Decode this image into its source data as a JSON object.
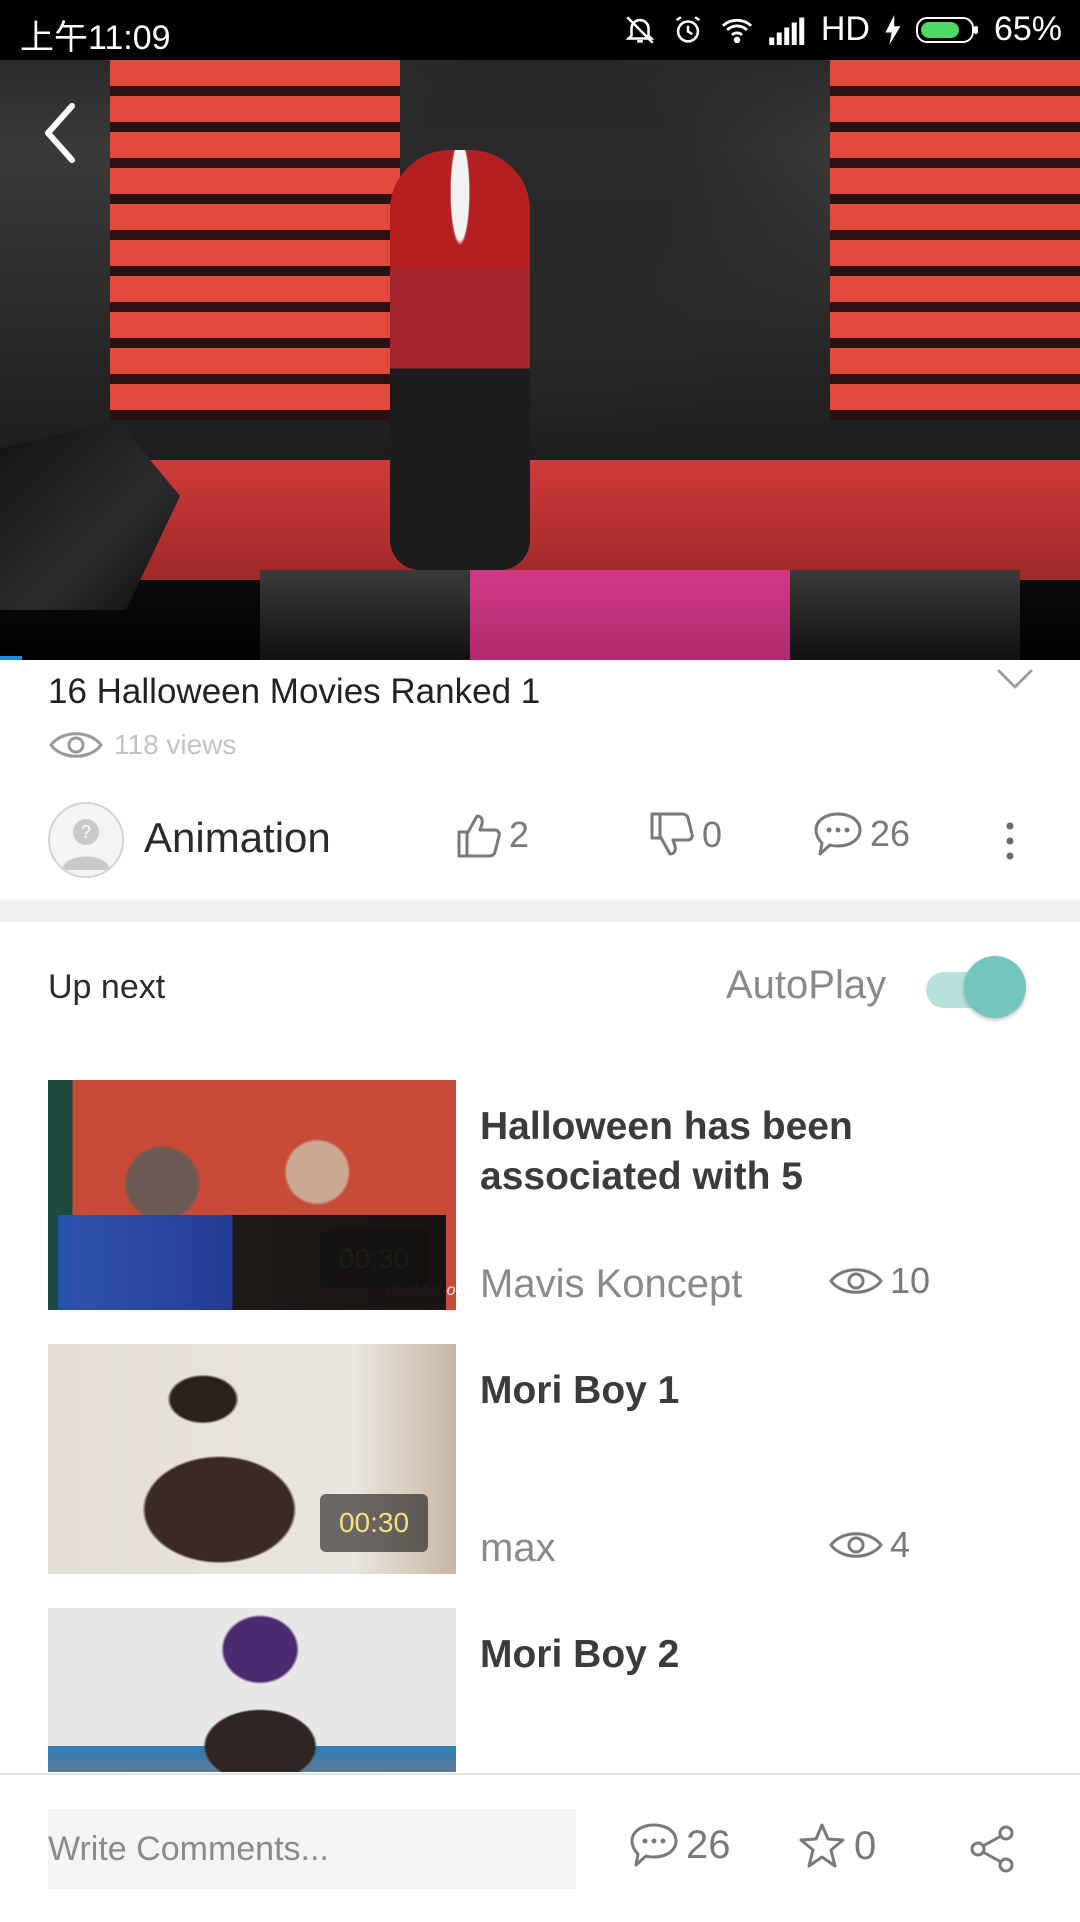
{
  "status_bar": {
    "time": "上午11:09",
    "network": "HD",
    "battery": "65%",
    "icons": [
      "mute-vibrate-icon",
      "alarm-icon",
      "wifi-icon",
      "signal-icon",
      "charging-icon",
      "battery-icon"
    ]
  },
  "video": {
    "title": "16 Halloween Movies Ranked 1",
    "views": "118 views",
    "channel": "Animation",
    "likes": "2",
    "dislikes": "0",
    "comments": "26"
  },
  "up_next": {
    "label": "Up next",
    "autoplay_label": "AutoPlay",
    "autoplay_on": true,
    "items": [
      {
        "title": "Halloween has been associated with 5",
        "author": "Mavis Koncept",
        "views": "10",
        "duration": "00:30",
        "watermark": "VivaVideo"
      },
      {
        "title": "Mori Boy 1",
        "author": "max",
        "views": "4",
        "duration": "00:30"
      },
      {
        "title": "Mori Boy 2"
      }
    ]
  },
  "bottom_bar": {
    "comment_placeholder": "Write Comments...",
    "comments_count": "26",
    "favorites_count": "0"
  },
  "colors": {
    "accent_teal": "#72c6bd",
    "progress_blue": "#1e88e5",
    "duration_text": "#f3e07a"
  }
}
